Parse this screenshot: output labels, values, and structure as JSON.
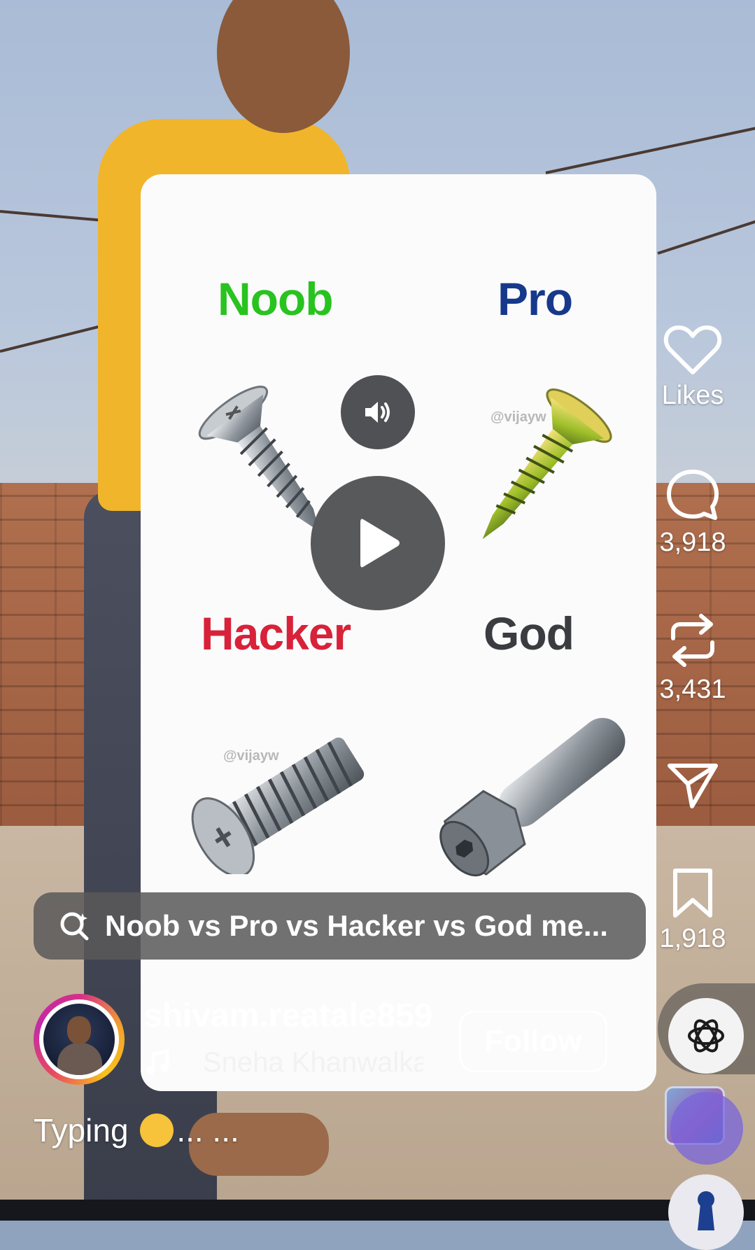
{
  "card": {
    "labels": {
      "noob": "Noob",
      "pro": "Pro",
      "hacker": "Hacker",
      "god": "God"
    },
    "watermark": "@vijayw",
    "watermark2": "@vijayw"
  },
  "media_controls": {
    "volume_icon": "speaker-icon",
    "play_icon": "play-icon"
  },
  "actions": {
    "like_label": "Likes",
    "comment_count": "3,918",
    "repost_count": "3,431",
    "save_count": "1,918"
  },
  "search": {
    "text": "Noob vs Pro vs Hacker vs God me..."
  },
  "author": {
    "username": "shivam.reatale859",
    "audio": "Sneha Khanwalka",
    "follow_label": "Follow"
  },
  "caption": {
    "text_before": "Typing",
    "text_after": "... ..."
  },
  "colors": {
    "noob": "#29c31f",
    "pro": "#17398c",
    "hacker": "#d8223a",
    "god": "#3a3c40"
  }
}
